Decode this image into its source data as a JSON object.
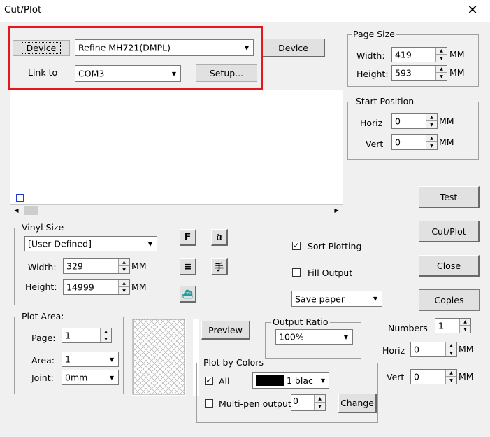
{
  "window": {
    "title": "Cut/Plot",
    "close_icon": "close-icon"
  },
  "device": {
    "button_label": "Device",
    "model_value": "Refine MH721(DMPL)",
    "second_button_label": "Device",
    "link_label": "Link to",
    "port_value": "COM3",
    "setup_label": "Setup..."
  },
  "page_size": {
    "legend": "Page Size",
    "width_label": "Width:",
    "width_value": "419",
    "height_label": "Height:",
    "height_value": "593",
    "unit": "MM"
  },
  "start_position": {
    "legend": "Start Position",
    "horiz_label": "Horiz",
    "horiz_value": "0",
    "vert_label": "Vert",
    "vert_value": "0",
    "unit": "MM"
  },
  "actions": {
    "test": "Test",
    "cutplot": "Cut/Plot",
    "close": "Close",
    "copies": "Copies"
  },
  "vinyl": {
    "legend": "Vinyl Size",
    "preset": "[User Defined]",
    "width_label": "Width:",
    "width_value": "329",
    "height_label": "Height:",
    "height_value": "14999",
    "unit": "MM"
  },
  "tools": {
    "icons": [
      "font-f-icon",
      "mirror-figure-icon",
      "align-lines-icon",
      "hand-char-icon",
      "plot-graphic-icon"
    ],
    "glyph_f": "F",
    "glyph_lines": "≡",
    "glyph_man": "ስ",
    "glyph_hand": "手",
    "glyph_plot": "⛴"
  },
  "options": {
    "sort_plotting": "Sort Plotting",
    "sort_checked": true,
    "fill_output": "Fill Output",
    "fill_checked": false,
    "save_mode": "Save paper"
  },
  "plot_area": {
    "legend": "Plot Area:",
    "page_label": "Page:",
    "page_value": "1",
    "area_label": "Area:",
    "area_value": "1",
    "joint_label": "Joint:",
    "joint_value": "0mm"
  },
  "preview": {
    "button": "Preview"
  },
  "output_ratio": {
    "legend": "Output Ratio",
    "value": "100%"
  },
  "copies_panel": {
    "numbers_label": "Numbers",
    "numbers_value": "1",
    "horiz_label": "Horiz",
    "horiz_value": "0",
    "vert_label": "Vert",
    "vert_value": "0",
    "unit": "MM"
  },
  "plot_by_colors": {
    "legend": "Plot by Colors",
    "all_label": "All",
    "all_checked": true,
    "color_label": "1 blac",
    "swatch_color": "#000000",
    "multipen_label": "Multi-pen output",
    "multipen_checked": false,
    "multipen_value": "0",
    "change_label": "Change"
  },
  "highlight_color": "#e8141e",
  "preview_border_color": "#1e3cd2"
}
